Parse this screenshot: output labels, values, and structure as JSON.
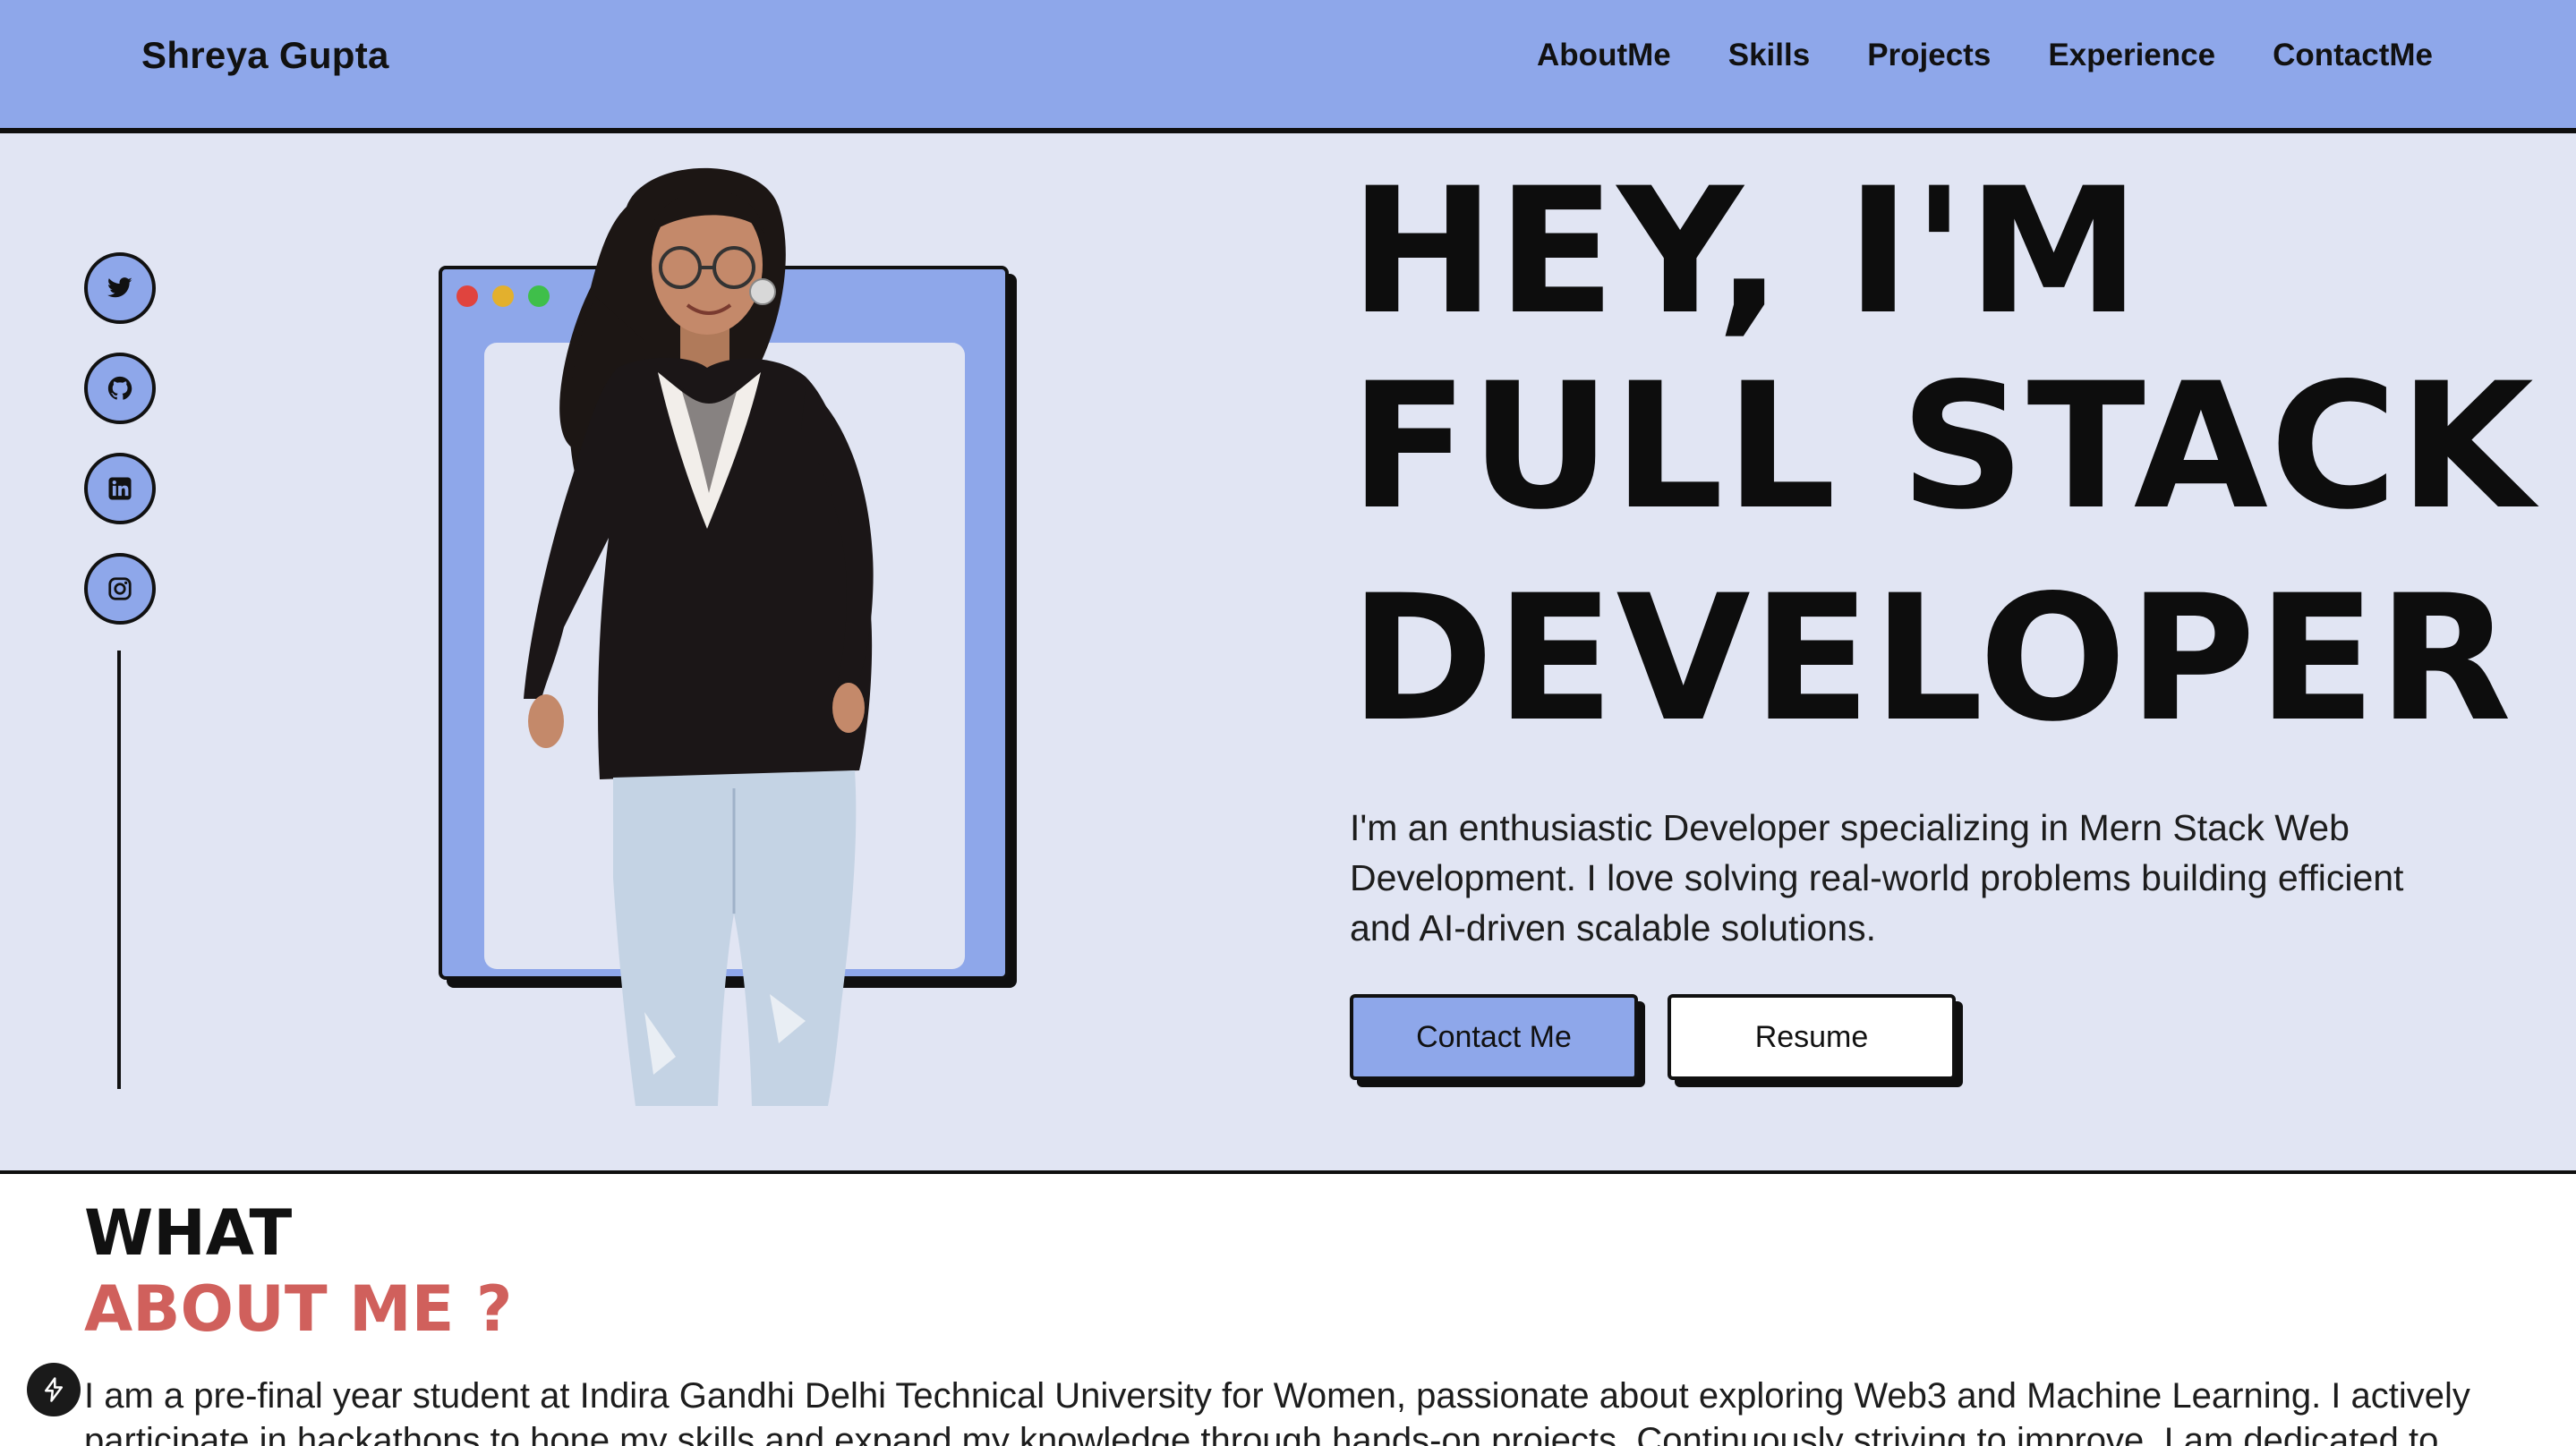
{
  "header": {
    "brand": "Shreya Gupta",
    "nav": [
      "AboutMe",
      "Skills",
      "Projects",
      "Experience",
      "ContactMe"
    ]
  },
  "social": {
    "icons": [
      "twitter-icon",
      "github-icon",
      "linkedin-icon",
      "instagram-icon"
    ]
  },
  "hero": {
    "title_line1": "HEY, I'M",
    "title_line2": "FULL STACK",
    "title_line3": "DEVELOPER",
    "description": "I'm an enthusiastic Developer specializing in Mern Stack Web Development. I love solving real-world problems building efficient and AI-driven scalable solutions.",
    "contact_button": "Contact Me",
    "resume_button": "Resume"
  },
  "about": {
    "heading_line1": "WHAT",
    "heading_line2": "ABOUT ME ?",
    "body": "I am a pre-final year student at Indira Gandhi Delhi Technical University for Women, passionate about exploring Web3 and Machine Learning. I actively participate in hackathons to hone my skills and expand my knowledge through hands-on projects. Continuously striving to improve, I am dedicated to"
  },
  "colors": {
    "accent_blue": "#8ea7ea",
    "hero_bg": "#e1e5f3",
    "about_accent": "#d0605c",
    "window_dots": [
      "#e0443e",
      "#e3b02d",
      "#3fbf4a"
    ]
  }
}
